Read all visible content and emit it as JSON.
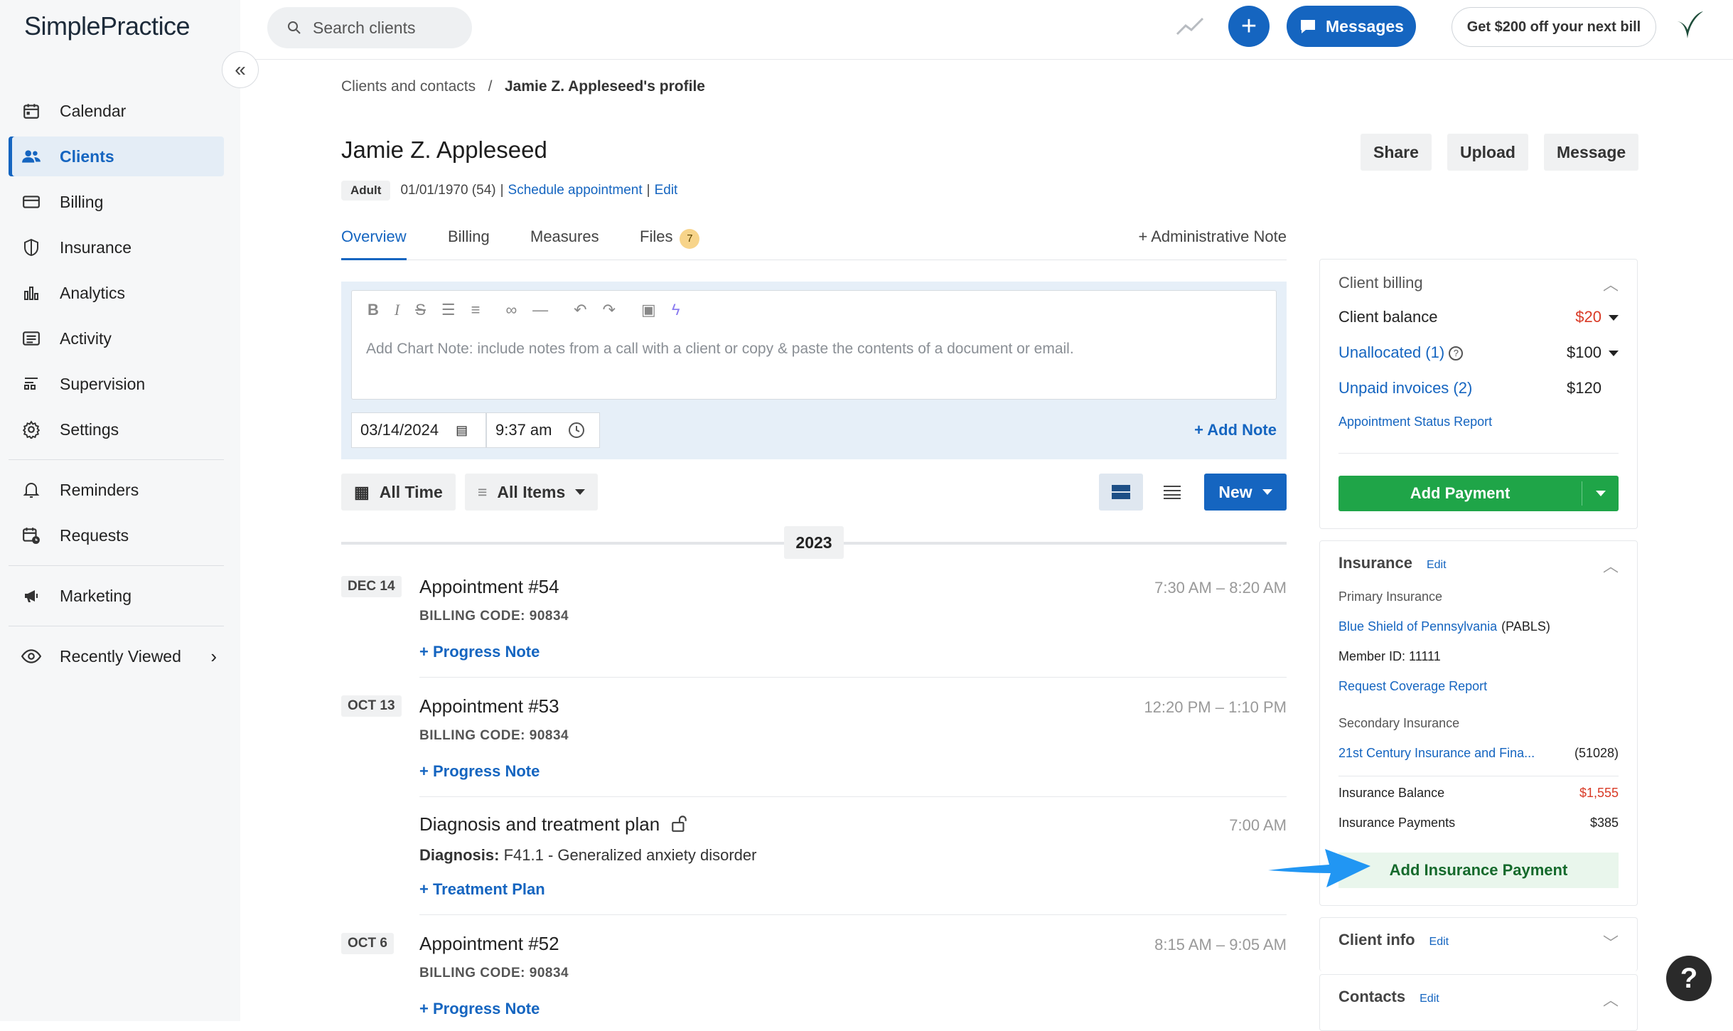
{
  "brand": {
    "logo_text": "SimplePractice"
  },
  "sidebar": {
    "items": [
      {
        "label": "Calendar",
        "icon": "calendar-icon"
      },
      {
        "label": "Clients",
        "icon": "people-icon",
        "active": true
      },
      {
        "label": "Billing",
        "icon": "card-icon"
      },
      {
        "label": "Insurance",
        "icon": "shield-icon"
      },
      {
        "label": "Analytics",
        "icon": "bar-chart-icon"
      },
      {
        "label": "Activity",
        "icon": "list-icon"
      },
      {
        "label": "Supervision",
        "icon": "supervision-icon"
      },
      {
        "label": "Settings",
        "icon": "gear-icon"
      }
    ],
    "secondary": [
      {
        "label": "Reminders",
        "icon": "bell-icon"
      },
      {
        "label": "Requests",
        "icon": "calendar-clock-icon"
      }
    ],
    "marketing": {
      "label": "Marketing",
      "icon": "megaphone-icon"
    },
    "recently_viewed": {
      "label": "Recently Viewed",
      "icon": "eye-icon"
    }
  },
  "topbar": {
    "search_placeholder": "Search clients",
    "messages_label": "Messages",
    "promo_label": "Get $200 off your next bill"
  },
  "breadcrumb": {
    "parent": "Clients and contacts",
    "separator": "/",
    "current": "Jamie Z. Appleseed's profile"
  },
  "client": {
    "name": "Jamie Z. Appleseed",
    "tag": "Adult",
    "dob": "01/01/1970 (54)",
    "sep": "|",
    "schedule_link": "Schedule appointment",
    "edit_link": "Edit"
  },
  "header_actions": {
    "share": "Share",
    "upload": "Upload",
    "message": "Message"
  },
  "tabs": {
    "overview": "Overview",
    "billing": "Billing",
    "measures": "Measures",
    "files": "Files",
    "files_count": "7",
    "admin_note": "+ Administrative Note"
  },
  "editor": {
    "placeholder": "Add Chart Note: include notes from a call with a client or copy & paste the contents of a document or email.",
    "date": "03/14/2024",
    "time": "9:37 am",
    "add_note": "+ Add Note"
  },
  "filters": {
    "time": "All Time",
    "items": "All Items",
    "new": "New"
  },
  "timeline": {
    "year": "2023",
    "entries": [
      {
        "date": "DEC 14",
        "title": "Appointment #54",
        "code": "BILLING CODE: 90834",
        "link": "+ Progress Note",
        "time": "7:30 AM – 8:20 AM"
      },
      {
        "date": "OCT 13",
        "title": "Appointment #53",
        "code": "BILLING CODE: 90834",
        "link": "+ Progress Note",
        "time": "12:20 PM – 1:10 PM"
      },
      {
        "date": "",
        "title": "Diagnosis and treatment plan",
        "diagnosis_label": "Diagnosis:",
        "diagnosis_value": "F41.1 - Generalized anxiety disorder",
        "link": "+ Treatment Plan",
        "time": "7:00 AM"
      },
      {
        "date": "OCT 6",
        "title": "Appointment #52",
        "code": "BILLING CODE: 90834",
        "link": "+ Progress Note",
        "time": "8:15 AM – 9:05 AM"
      }
    ]
  },
  "client_billing": {
    "title": "Client billing",
    "balance_label": "Client balance",
    "balance_value": "$20",
    "unallocated_label": "Unallocated (1)",
    "unallocated_value": "$100",
    "unpaid_label": "Unpaid invoices (2)",
    "unpaid_value": "$120",
    "report_link": "Appointment Status Report",
    "add_payment": "Add Payment"
  },
  "insurance": {
    "title": "Insurance",
    "edit": "Edit",
    "primary_label": "Primary Insurance",
    "primary_name": "Blue Shield of Pennsylvania",
    "primary_code": "(PABLS)",
    "member_id": "Member ID: 11111",
    "coverage_link": "Request Coverage Report",
    "secondary_label": "Secondary Insurance",
    "secondary_name": "21st Century Insurance and Fina...",
    "secondary_code": "(51028)",
    "balance_label": "Insurance Balance",
    "balance_value": "$1,555",
    "payments_label": "Insurance Payments",
    "payments_value": "$385",
    "add_payment": "Add Insurance Payment"
  },
  "client_info": {
    "title": "Client info",
    "edit": "Edit"
  },
  "contacts": {
    "title": "Contacts",
    "edit": "Edit"
  },
  "help": {
    "label": "?"
  },
  "colors": {
    "accent": "#1565c0",
    "green": "#1fa548",
    "red": "#d93a26"
  }
}
